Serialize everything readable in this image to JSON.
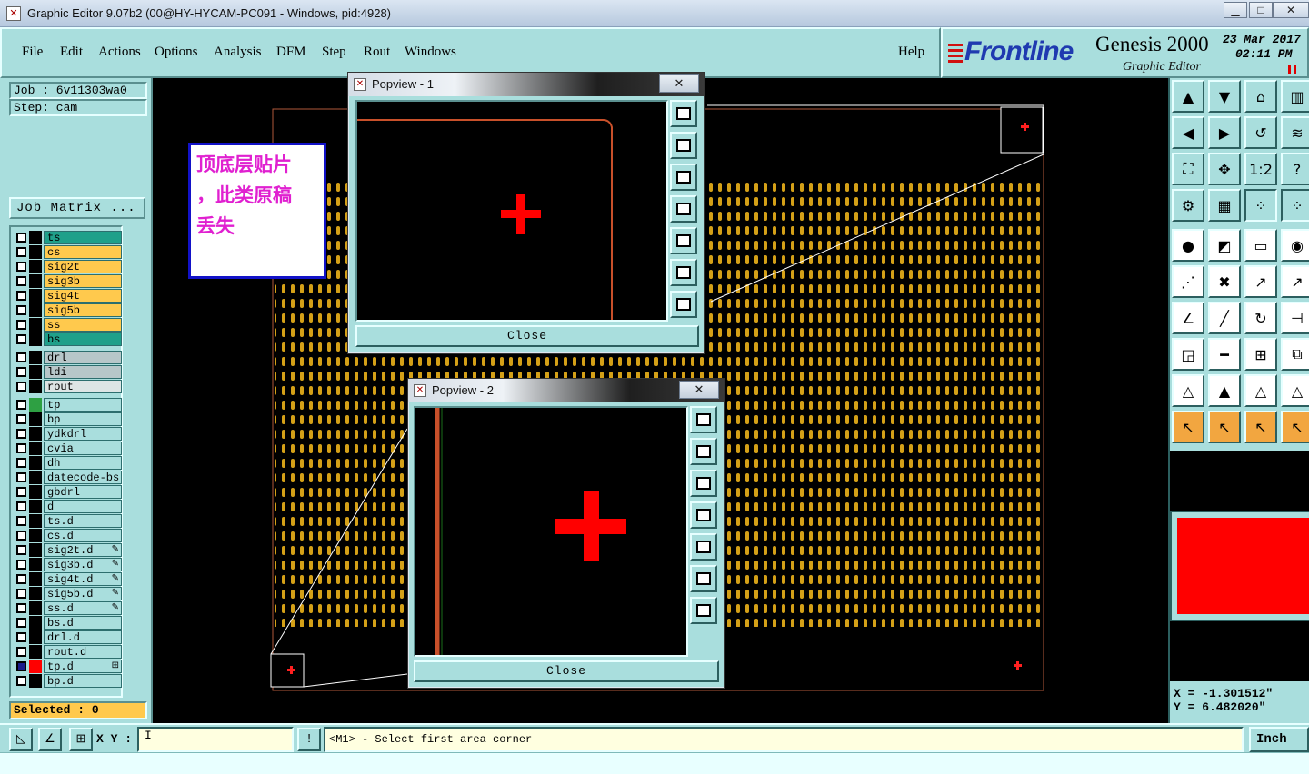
{
  "window": {
    "title": "Graphic Editor 9.07b2 (00@HY-HYCAM-PC091 - Windows, pid:4928)",
    "min_glyph": "▁",
    "max_glyph": "□",
    "close_glyph": "✕"
  },
  "menu": {
    "items": [
      "File",
      "Edit",
      "Actions",
      "Options",
      "Analysis",
      "DFM",
      "Step",
      "Rout",
      "Windows"
    ],
    "help": "Help"
  },
  "brand": {
    "logo": "Frontline",
    "product": "Genesis 2000",
    "subtitle": "Graphic Editor",
    "date": "23 Mar 2017",
    "time": "02:11 PM"
  },
  "left_panel": {
    "job": "Job : 6v11303wa0",
    "step": "Step: cam",
    "job_matrix": "Job Matrix ...",
    "selected": "Selected : 0",
    "layer_groups": [
      {
        "layers": [
          {
            "name": "ts",
            "color": "#1fa08a",
            "swatch": "#000000"
          },
          {
            "name": "cs",
            "color": "#ffc94d",
            "swatch": "#000000"
          },
          {
            "name": "sig2t",
            "color": "#ffc94d",
            "swatch": "#000000"
          },
          {
            "name": "sig3b",
            "color": "#ffc94d",
            "swatch": "#000000"
          },
          {
            "name": "sig4t",
            "color": "#ffc94d",
            "swatch": "#000000"
          },
          {
            "name": "sig5b",
            "color": "#ffc94d",
            "swatch": "#000000"
          },
          {
            "name": "ss",
            "color": "#ffc94d",
            "swatch": "#000000"
          },
          {
            "name": "bs",
            "color": "#1fa08a",
            "swatch": "#000000"
          }
        ]
      },
      {
        "layers": [
          {
            "name": "drl",
            "color": "#b7c7c9",
            "swatch": "#000000"
          },
          {
            "name": "ldi",
            "color": "#b7c7c9",
            "swatch": "#000000"
          },
          {
            "name": "rout",
            "color": "#dde5e5",
            "swatch": "#000000"
          }
        ]
      },
      {
        "layers": [
          {
            "name": "tp",
            "color": "#a9dedd",
            "swatch": "#2ea043"
          },
          {
            "name": "bp",
            "color": "#a9dedd",
            "swatch": "#000000"
          },
          {
            "name": "ydkdrl",
            "color": "#a9dedd",
            "swatch": "#000000"
          },
          {
            "name": "cvia",
            "color": "#a9dedd",
            "swatch": "#000000"
          },
          {
            "name": "dh",
            "color": "#a9dedd",
            "swatch": "#000000"
          },
          {
            "name": "datecode-bs",
            "color": "#a9dedd",
            "swatch": "#000000"
          },
          {
            "name": "gbdrl",
            "color": "#a9dedd",
            "swatch": "#000000"
          },
          {
            "name": "d",
            "color": "#a9dedd",
            "swatch": "#000000"
          },
          {
            "name": "ts.d",
            "color": "#a9dedd",
            "swatch": "#000000"
          },
          {
            "name": "cs.d",
            "color": "#a9dedd",
            "swatch": "#000000"
          },
          {
            "name": "sig2t.d",
            "color": "#a9dedd",
            "swatch": "#000000",
            "mark": "✎"
          },
          {
            "name": "sig3b.d",
            "color": "#a9dedd",
            "swatch": "#000000",
            "mark": "✎"
          },
          {
            "name": "sig4t.d",
            "color": "#a9dedd",
            "swatch": "#000000",
            "mark": "✎"
          },
          {
            "name": "sig5b.d",
            "color": "#a9dedd",
            "swatch": "#000000",
            "mark": "✎"
          },
          {
            "name": "ss.d",
            "color": "#a9dedd",
            "swatch": "#000000",
            "mark": "✎"
          },
          {
            "name": "bs.d",
            "color": "#a9dedd",
            "swatch": "#000000"
          },
          {
            "name": "drl.d",
            "color": "#a9dedd",
            "swatch": "#000000"
          },
          {
            "name": "rout.d",
            "color": "#a9dedd",
            "swatch": "#000000"
          },
          {
            "name": "tp.d",
            "color": "#a9dedd",
            "swatch": "#ff0000",
            "checked": true,
            "mark": "⊞"
          },
          {
            "name": "bp.d",
            "color": "#a9dedd",
            "swatch": "#000000"
          }
        ]
      }
    ]
  },
  "annotation": {
    "text_line1": "顶底层贴片",
    "text_line2": "，此类原稿",
    "text_line3": "丢失"
  },
  "popview1": {
    "title": "Popview - 1",
    "close_label": "Close",
    "close_glyph": "✕"
  },
  "popview2": {
    "title": "Popview - 2",
    "close_label": "Close",
    "close_glyph": "✕"
  },
  "tools": {
    "labels": {
      "ratio": "1:2",
      "help": "?"
    }
  },
  "coords": {
    "x": "X  =  -1.301512\"",
    "y": "Y  =  6.482020\""
  },
  "bottom_bar": {
    "xy_label": "X Y :",
    "xy_value": "I",
    "prompt": "<M1> - Select first area corner",
    "units": "Inch"
  },
  "colors": {
    "panel": "#a9dedd",
    "pad": "#d4a017",
    "highlight": "#ff0000",
    "annotation_text": "#e020d0",
    "annotation_border": "#1212c8"
  }
}
